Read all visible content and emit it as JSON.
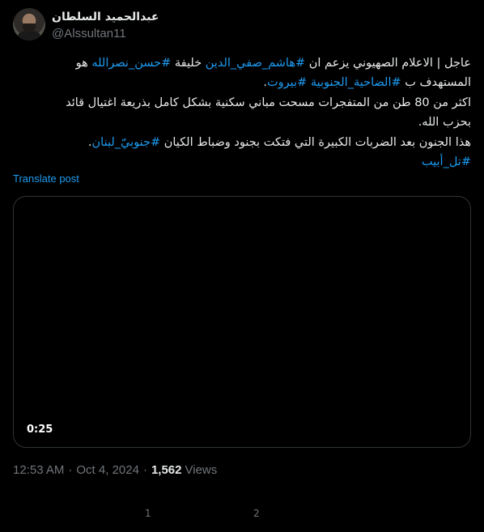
{
  "author": {
    "display_name": "عبدالحميد السلطان",
    "handle": "@Alssultan11"
  },
  "post": {
    "line1_part1": "عاجل | الاعلام الصهيوني يزعم ان ",
    "line1_tag1": "#هاشم_صفي_الدين",
    "line1_part2": " خليفة ",
    "line1_tag2": "#حسن_نصرالله",
    "line1_part3": " هو",
    "line2_part1": "المستهدف ب ",
    "line2_tag1": "#الضاحية_الجنوبية",
    "line2_part2": " ",
    "line2_tag2": "#بيروت",
    "line2_part3": ".",
    "line3": "اكثر من 80 طن من المتفجرات مسحت مباني سكنية بشكل كامل بذريعة اغتيال قائد",
    "line4": "بحزب الله.",
    "line5_part1": "هذا الجنون بعد الضربات الكبيرة التي فتكت بجنود وضباط الكيان ",
    "line5_tag1": "#جنوبيّ_لبنان",
    "line5_part2": ".",
    "line6_tag1": "#تل_أبيب"
  },
  "translate_label": "Translate post",
  "media": {
    "duration": "0:25"
  },
  "meta": {
    "time": "12:53 AM",
    "separator": "·",
    "date": "Oct 4, 2024",
    "views_count": "1,562",
    "views_label": "Views"
  },
  "stats": {
    "first": "1",
    "second": "2"
  },
  "colors": {
    "background": "#000000",
    "text": "#e7e9ea",
    "muted": "#71767b",
    "link": "#1d9bf0",
    "border": "#2f3336"
  }
}
